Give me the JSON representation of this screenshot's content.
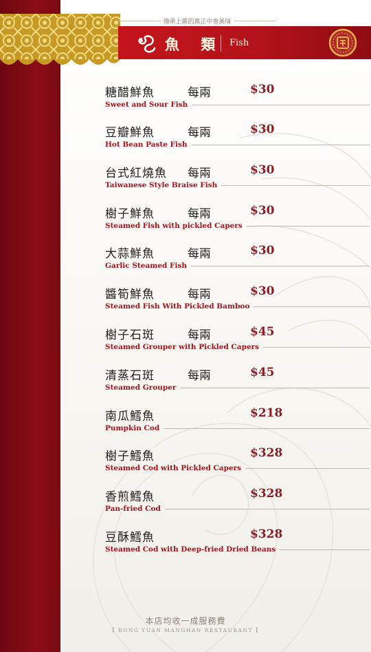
{
  "header": {
    "tagline": "傳承上乘的真正中食美味",
    "title_zh": "魚 類",
    "title_en": "Fish",
    "colors": {
      "banner": "#c4151b",
      "side_band": "#7a0912",
      "english_text": "#a5131b",
      "price_text": "#8e1d24"
    }
  },
  "menu": [
    {
      "zh": "糖醋鮮魚",
      "unit": "每兩",
      "price": "$30",
      "en": "Sweet and Sour Fish"
    },
    {
      "zh": "豆瓣鮮魚",
      "unit": "每兩",
      "price": "$30",
      "en": "Hot Bean Paste Fish"
    },
    {
      "zh": "台式紅燒魚",
      "unit": "每兩",
      "price": "$30",
      "en": "Taiwanese Style Braise Fish"
    },
    {
      "zh": "樹子鮮魚",
      "unit": "每兩",
      "price": "$30",
      "en": "Steamed Fish with pickled Capers"
    },
    {
      "zh": "大蒜鮮魚",
      "unit": "每兩",
      "price": "$30",
      "en": "Garlic Steamed Fish"
    },
    {
      "zh": "醬筍鮮魚",
      "unit": "每兩",
      "price": "$30",
      "en": "Steamed Fish With Pickled Bamboo"
    },
    {
      "zh": "樹子石斑",
      "unit": "每兩",
      "price": "$45",
      "en": "Steamed Grouper with Pickled Capers"
    },
    {
      "zh": "清蒸石斑",
      "unit": "每兩",
      "price": "$45",
      "en": "Steamed Grouper"
    },
    {
      "zh": "南瓜鱈魚",
      "unit": "",
      "price": "$218",
      "en": "Pumpkin Cod"
    },
    {
      "zh": "樹子鱈魚",
      "unit": "",
      "price": "$328",
      "en": "Steamed Cod with Pickled Capers"
    },
    {
      "zh": "香煎鱈魚",
      "unit": "",
      "price": "$328",
      "en": "Pan-fried Cod"
    },
    {
      "zh": "豆酥鱈魚",
      "unit": "",
      "price": "$328",
      "en": "Steamed Cod with Deep-fried Dried Beans"
    }
  ],
  "footer": {
    "service_note": "本店均收一成服務費",
    "restaurant": "【 RONG YUAN MANGHAN RESTAURANT 】"
  }
}
